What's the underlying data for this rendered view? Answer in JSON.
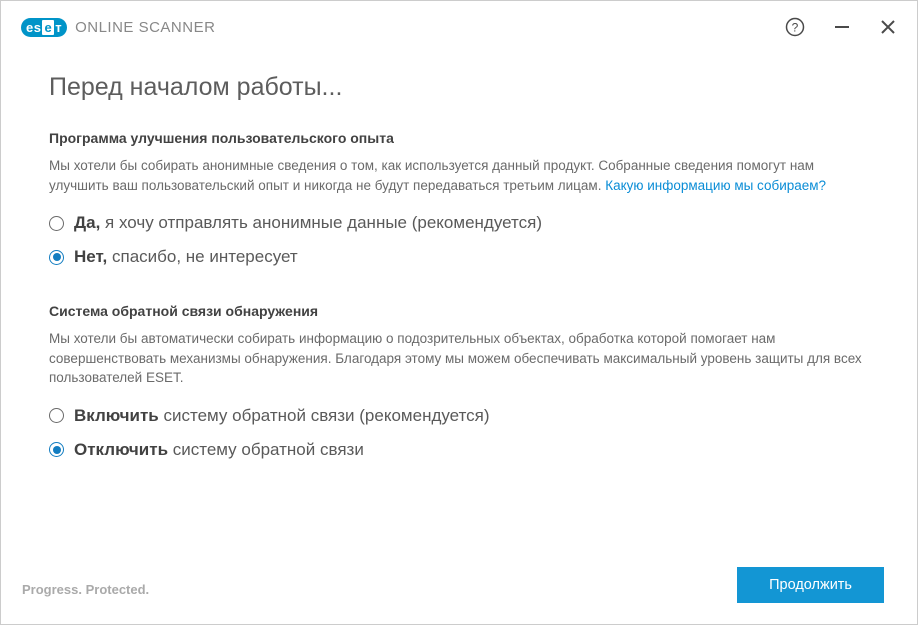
{
  "brand": {
    "product_name": "ONLINE SCANNER",
    "tagline": "Progress. Protected."
  },
  "page": {
    "title": "Перед началом работы..."
  },
  "section1": {
    "heading": "Программа улучшения пользовательского опыта",
    "desc": "Мы хотели бы собирать анонимные сведения о том, как используется данный продукт. Собранные сведения помогут нам улучшить ваш пользовательский опыт и никогда не будут передаваться третьим лицам. ",
    "link": "Какую информацию мы собираем?",
    "option_yes_bold": "Да,",
    "option_yes_rest": " я хочу отправлять анонимные данные (рекомендуется)",
    "option_no_bold": "Нет,",
    "option_no_rest": " спасибо, не интересует",
    "selected": "no"
  },
  "section2": {
    "heading": "Система обратной связи обнаружения",
    "desc": "Мы хотели бы автоматически собирать информацию о подозрительных объектах, обработка которой помогает нам совершенствовать механизмы обнаружения. Благодаря этому мы можем обеспечивать максимальный уровень защиты для всех пользователей ESET.",
    "option_on_bold": "Включить",
    "option_on_rest": " систему обратной связи (рекомендуется)",
    "option_off_bold": "Отключить",
    "option_off_rest": " систему обратной связи",
    "selected": "off"
  },
  "buttons": {
    "continue": "Продолжить"
  }
}
